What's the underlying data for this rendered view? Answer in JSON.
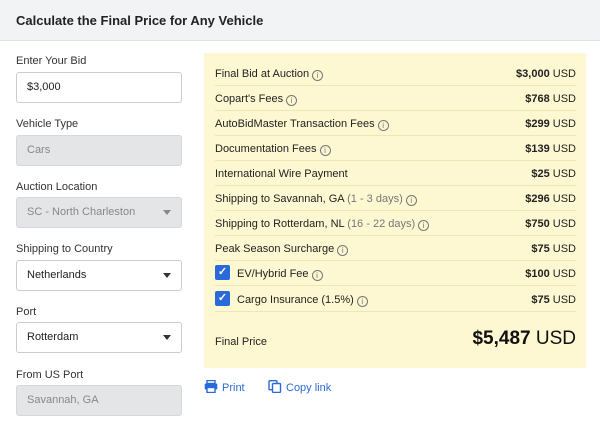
{
  "header": {
    "title": "Calculate the Final Price for Any Vehicle"
  },
  "form": {
    "bid": {
      "label": "Enter Your Bid",
      "value": "$3,000"
    },
    "vehicle_type": {
      "label": "Vehicle Type",
      "value": "Cars"
    },
    "auction_location": {
      "label": "Auction Location",
      "value": "SC - North Charleston"
    },
    "shipping_country": {
      "label": "Shipping to Country",
      "value": "Netherlands"
    },
    "port": {
      "label": "Port",
      "value": "Rotterdam"
    },
    "from_port": {
      "label": "From US Port",
      "value": "Savannah, GA"
    }
  },
  "summary": {
    "rows": [
      {
        "label": "Final Bid at Auction",
        "sub": "",
        "amount": "$3,000",
        "unit": "USD"
      },
      {
        "label": "Copart's Fees",
        "sub": "",
        "amount": "$768",
        "unit": "USD"
      },
      {
        "label": "AutoBidMaster Transaction Fees",
        "sub": "",
        "amount": "$299",
        "unit": "USD"
      },
      {
        "label": "Documentation Fees",
        "sub": "",
        "amount": "$139",
        "unit": "USD"
      },
      {
        "label": "International Wire Payment",
        "sub": "",
        "amount": "$25",
        "unit": "USD"
      },
      {
        "label": "Shipping to Savannah, GA",
        "sub": "(1 - 3 days)",
        "amount": "$296",
        "unit": "USD"
      },
      {
        "label": "Shipping to Rotterdam, NL",
        "sub": "(16 - 22 days)",
        "amount": "$750",
        "unit": "USD"
      },
      {
        "label": "Peak Season Surcharge",
        "sub": "",
        "amount": "$75",
        "unit": "USD"
      },
      {
        "label": "EV/Hybrid Fee",
        "sub": "",
        "amount": "$100",
        "unit": "USD",
        "checked": true
      },
      {
        "label": "Cargo Insurance (1.5%)",
        "sub": "",
        "amount": "$75",
        "unit": "USD",
        "checked": true
      }
    ],
    "final": {
      "label": "Final Price",
      "amount": "$5,487",
      "unit": "USD"
    }
  },
  "actions": {
    "print": "Print",
    "copy": "Copy link"
  },
  "colors": {
    "accent": "#2a6ad8",
    "panel": "#fdf8d1",
    "header": "#f1f3f5"
  },
  "icons": {
    "info": "info-icon",
    "print": "print-icon",
    "copy": "copy-icon",
    "check": "checkmark-icon"
  }
}
